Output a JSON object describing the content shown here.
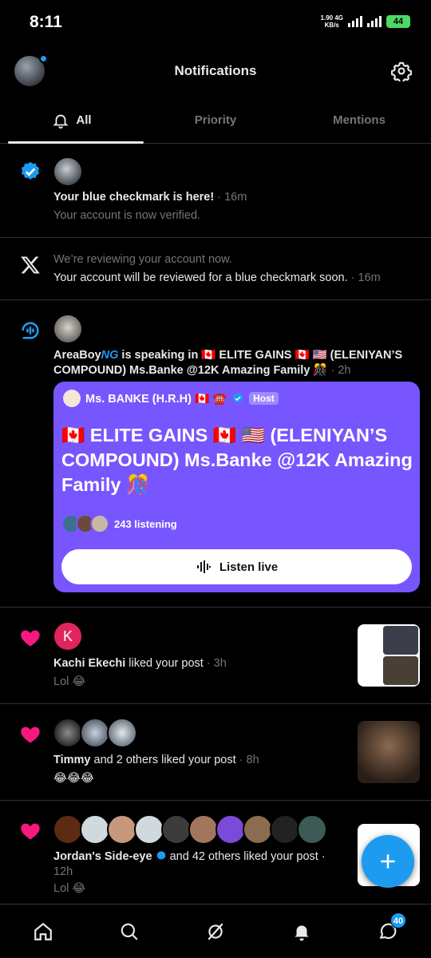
{
  "status_bar": {
    "time": "8:11",
    "net_speed": "1.90",
    "net_unit": "KB/s",
    "net_type": "4G",
    "battery": "44"
  },
  "header": {
    "title": "Notifications",
    "settings_icon": "gear-icon"
  },
  "tabs": [
    {
      "label": "All"
    },
    {
      "label": "Priority"
    },
    {
      "label": "Mentions"
    }
  ],
  "notifications": {
    "verified": {
      "title": "Your blue checkmark is here!",
      "time": "· 16m",
      "subtitle": "Your account is now verified."
    },
    "review": {
      "line1": "We’re reviewing your account now.",
      "line2": "Your account will be reviewed for a blue checkmark soon.",
      "time": "· 16m"
    },
    "space": {
      "user": "AreaBoy",
      "user_suffix": "NG",
      "action": "is speaking in 🇨🇦 ELITE GAINS 🇨🇦 🇺🇸 (ELENIYAN’S COMPOUND) Ms.Banke @12K Amazing Family 🎊",
      "time": "· 2h",
      "card": {
        "host_name": "Ms. BANKE (H.R.H) 🇨🇦 ☎️",
        "host_badge": "Host",
        "title": "🇨🇦 ELITE GAINS 🇨🇦 🇺🇸 (ELENIYAN’S COMPOUND) Ms.Banke @12K Amazing Family 🎊",
        "listening": "243 listening",
        "button": "Listen live"
      }
    },
    "like1": {
      "avatar_letter": "K",
      "user": "Kachi Ekechi",
      "action": "liked your post",
      "time": "· 3h",
      "text": "Lol 😂"
    },
    "like2": {
      "user": "Timmy",
      "action": "and 2 others liked your post",
      "time": "· 8h",
      "text": "😂😂😂"
    },
    "like3": {
      "user": "Jordan's Side-eye",
      "action": "and 42 others liked your post ·",
      "time": "12h",
      "text": "Lol 😂"
    }
  },
  "nav": {
    "messages_badge": "40"
  },
  "colors": {
    "accent": "#1d9bf0",
    "like": "#f91880",
    "space": "#7856ff",
    "background": "#000000"
  }
}
